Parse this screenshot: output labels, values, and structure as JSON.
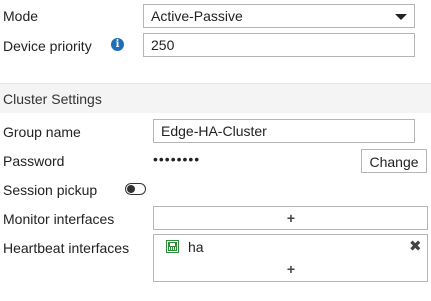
{
  "ha": {
    "mode_label": "Mode",
    "mode_value": "Active-Passive",
    "priority_label": "Device priority",
    "priority_value": "250"
  },
  "cluster": {
    "section_title": "Cluster Settings",
    "group_name_label": "Group name",
    "group_name_value": "Edge-HA-Cluster",
    "password_label": "Password",
    "password_mask": "••••••••",
    "change_button": "Change",
    "session_pickup_label": "Session pickup",
    "session_pickup_enabled": false,
    "monitor_label": "Monitor interfaces",
    "heartbeat_label": "Heartbeat interfaces",
    "heartbeat_interfaces": [
      "ha"
    ],
    "add_symbol": "+",
    "remove_symbol": "✖"
  },
  "icons": {
    "info": "info-icon",
    "dropdown": "chevron-down-icon",
    "interface": "network-port-icon",
    "remove": "close-icon"
  },
  "colors": {
    "accent_blue": "#1f6fb8",
    "port_green": "#2e8b3a",
    "section_bg": "#f4f4f4"
  }
}
